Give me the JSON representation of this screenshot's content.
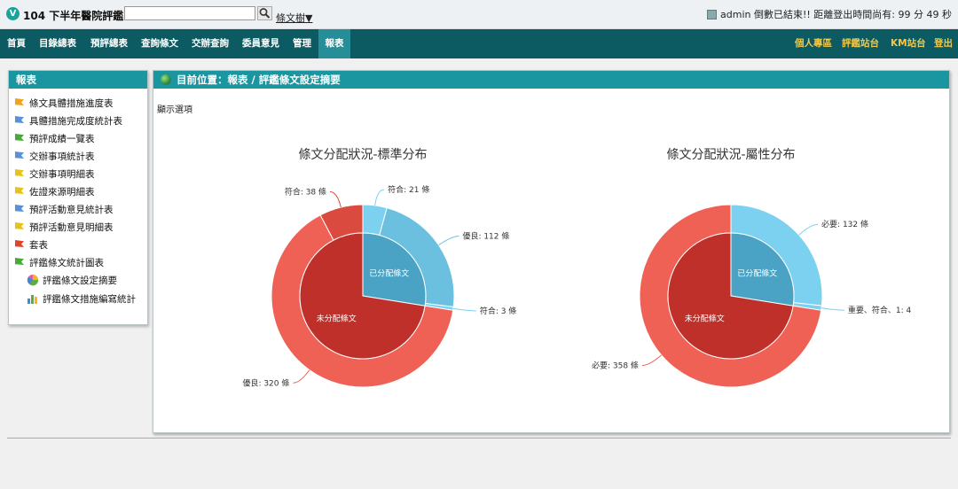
{
  "header": {
    "logo_letter": "V",
    "app_title": "104 下半年醫院評鑑",
    "search": {
      "value": "",
      "placeholder": ""
    },
    "tree_link": "條文樹▼",
    "user_status": "admin 倒數已結束!! 距離登出時間尚有: 99 分 49 秒"
  },
  "nav": {
    "items": [
      "首頁",
      "目錄總表",
      "預評總表",
      "查詢條文",
      "交辦查詢",
      "委員意見",
      "管理",
      "報表"
    ],
    "active": "報表",
    "right_items": [
      "個人專區",
      "評鑑站台",
      "KM站台",
      "登出"
    ]
  },
  "sidebar": {
    "title": "報表",
    "items": [
      {
        "label": "條文具體措施進度表",
        "icon": "flag-orange-icon",
        "color": "#f2a31c"
      },
      {
        "label": "具體措施完成度統計表",
        "icon": "flag-blue-icon",
        "color": "#5b8fd6"
      },
      {
        "label": "預評成績一覽表",
        "icon": "flag-green-icon",
        "color": "#4aa83a"
      },
      {
        "label": "交辦事項統計表",
        "icon": "flag-blue-icon",
        "color": "#5b8fd6"
      },
      {
        "label": "交辦事項明細表",
        "icon": "flag-yellow-icon",
        "color": "#e6c21e"
      },
      {
        "label": "佐證來源明細表",
        "icon": "flag-yellow-icon",
        "color": "#e6c21e"
      },
      {
        "label": "預評活動意見統計表",
        "icon": "flag-blue-icon",
        "color": "#5b8fd6"
      },
      {
        "label": "預評活動意見明細表",
        "icon": "flag-yellow-icon",
        "color": "#e6c21e"
      },
      {
        "label": "套表",
        "icon": "flag-red-icon",
        "color": "#e0442c"
      },
      {
        "label": "評鑑條文統計圖表",
        "icon": "flag-green-icon",
        "color": "#4aa83a"
      }
    ],
    "sub_items": [
      {
        "label": "評鑑條文設定摘要",
        "icon": "pie-chart-icon"
      },
      {
        "label": "評鑑條文措施編寫統計",
        "icon": "bar-chart-icon"
      }
    ]
  },
  "main": {
    "breadcrumb": "目前位置：報表 / 評鑑條文設定摘要",
    "display_options": "顯示選項"
  },
  "chart_data": [
    {
      "type": "pie",
      "title": "條文分配狀況-標準分布",
      "inner": [
        {
          "name": "已分配條文",
          "value": 136,
          "color": "#4aa3c4"
        },
        {
          "name": "未分配條文",
          "value": 358,
          "color": "#c0302a"
        }
      ],
      "outer": [
        {
          "name": "符合",
          "value": 21,
          "unit": "條",
          "color": "#7dd1f0"
        },
        {
          "name": "優良",
          "value": 112,
          "unit": "條",
          "color": "#6bc0df"
        },
        {
          "name": "符合",
          "value": 3,
          "unit": "條",
          "color": "#7dd1f0"
        },
        {
          "name": "優良",
          "value": 320,
          "unit": "條",
          "color": "#ef6055"
        },
        {
          "name": "符合",
          "value": 38,
          "unit": "條",
          "color": "#db4a3f"
        }
      ]
    },
    {
      "type": "pie",
      "title": "條文分配狀況-屬性分布",
      "inner": [
        {
          "name": "已分配條文",
          "value": 136,
          "color": "#4aa3c4"
        },
        {
          "name": "未分配條文",
          "value": 358,
          "color": "#c0302a"
        }
      ],
      "outer": [
        {
          "name": "必要",
          "value": 132,
          "unit": "條",
          "color": "#7dd1f0"
        },
        {
          "name": "重要、符合、1",
          "value": 4,
          "unit": "",
          "color": "#7dd1f0"
        },
        {
          "name": "必要",
          "value": 358,
          "unit": "條",
          "color": "#ef6055"
        }
      ]
    }
  ]
}
